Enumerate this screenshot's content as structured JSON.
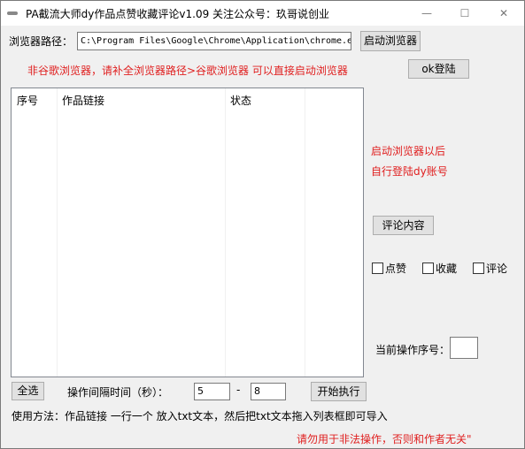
{
  "window": {
    "title": "PA截流大师dy作品点赞收藏评论v1.09  关注公众号：玖哥说创业",
    "minimize": "—",
    "maximize": "☐",
    "close": "✕"
  },
  "browser": {
    "path_label": "浏览器路径：",
    "path_value": "C:\\Program Files\\Google\\Chrome\\Application\\chrome.e",
    "launch_button": "启动浏览器",
    "hint": "非谷歌浏览器，请补全浏览器路径>谷歌浏览器 可以直接启动浏览器",
    "ok_login_button": "ok登陆"
  },
  "table": {
    "columns": [
      "序号",
      "作品链接",
      "状态"
    ]
  },
  "side": {
    "hint_line1": "启动浏览器以后",
    "hint_line2": "自行登陆dy账号",
    "comment_button": "评论内容",
    "checkboxes": [
      "点赞",
      "收藏",
      "评论"
    ],
    "current_index_label": "当前操作序号："
  },
  "bottom": {
    "select_all": "全选",
    "interval_label": "操作间隔时间（秒）：",
    "interval_min": "5",
    "dash": "-",
    "interval_max": "8",
    "start_button": "开始执行",
    "usage": "使用方法：作品链接 一行一个 放入txt文本，然后把txt文本拖入列表框即可导入",
    "warning": "请勿用于非法操作，否则和作者无关\""
  },
  "colors": {
    "accent_red": "#e02020"
  }
}
